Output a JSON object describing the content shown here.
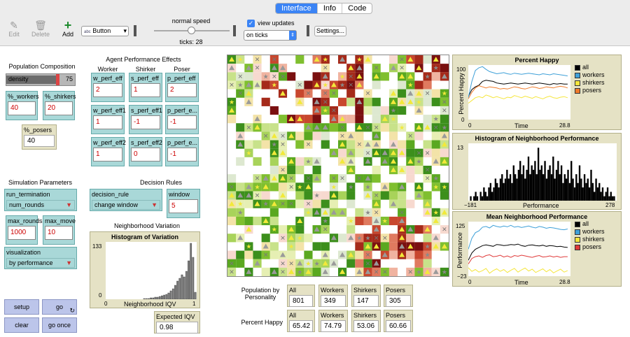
{
  "tabs": [
    "Interface",
    "Info",
    "Code"
  ],
  "toolbar": {
    "edit": "Edit",
    "delete": "Delete",
    "add": "Add",
    "widget_type": "Button",
    "speed_label": "normal speed",
    "ticks": "ticks: 28",
    "view_updates": "view updates",
    "update_mode": "on ticks",
    "settings": "Settings..."
  },
  "population": {
    "title": "Population Composition",
    "density_label": "density",
    "density_value": "75",
    "density_fraction": 0.75,
    "workers_label": "%_workers",
    "workers": "40",
    "shirkers_label": "%_shirkers",
    "shirkers": "20",
    "posers_label": "%_posers",
    "posers": "40"
  },
  "effects": {
    "title": "Agent Performance Effects",
    "col_worker": "Worker",
    "col_shirker": "Shirker",
    "col_poser": "Poser",
    "cells": [
      {
        "label": "w_perf_eff",
        "value": "2"
      },
      {
        "label": "s_perf_eff",
        "value": "1"
      },
      {
        "label": "p_perf_eff",
        "value": "2"
      },
      {
        "label": "w_perf_eff1",
        "value": "1"
      },
      {
        "label": "s_perf_eff1",
        "value": "-1"
      },
      {
        "label": "p_perf_e...",
        "value": "-1"
      },
      {
        "label": "w_perf_eff2",
        "value": "1"
      },
      {
        "label": "s_perf_eff2",
        "value": "0"
      },
      {
        "label": "p_perf_e...",
        "value": "-1"
      }
    ]
  },
  "simulation": {
    "title": "Simulation Parameters",
    "run_termination_label": "run_termination",
    "run_termination": "num_rounds",
    "max_rounds_label": "max_rounds",
    "max_rounds": "1000",
    "max_move_label": "max_move",
    "max_move": "10",
    "visualization_label": "visualization",
    "visualization": "by performance"
  },
  "decision": {
    "title": "Decision Rules",
    "rule_label": "decision_rule",
    "rule": "change window",
    "window_label": "window",
    "window": "5"
  },
  "variation": {
    "title": "Neighborhood Variation",
    "hist_title": "Histogram of Variation",
    "y_max": "133",
    "y_min": "0",
    "x_min": "0",
    "x_max": "1",
    "x_label": "Neighborhood IQV",
    "expected_label": "Expected IQV",
    "expected": "0.98"
  },
  "controls": {
    "setup": "setup",
    "go": "go",
    "clear": "clear",
    "go_once": "go once"
  },
  "stats": {
    "pop_label": "Population by Personality",
    "happy_label": "Percent Happy",
    "headers": [
      "All",
      "Workers",
      "Shirkers",
      "Posers"
    ],
    "pop_values": [
      "801",
      "349",
      "147",
      "305"
    ],
    "happy_values": [
      "65.42",
      "74.79",
      "53.06",
      "60.66"
    ]
  },
  "legend_colors": {
    "all": "#000000",
    "workers": "#3ea0d8",
    "shirkers": "#f5e63c",
    "posers_orange": "#f07a2a",
    "posers_red": "#e03a3a"
  },
  "chart_data": [
    {
      "type": "line",
      "title": "Percent Happy",
      "ylabel": "Percent Happy",
      "xlabel": "Time",
      "ylim": [
        0,
        100
      ],
      "xlim": [
        0,
        28.8
      ],
      "y_top": "100",
      "y_bottom": "0",
      "x_left": "0",
      "x_right": "28.8",
      "x": [
        0,
        1,
        2,
        3,
        4,
        5,
        6,
        7,
        8,
        9,
        10,
        11,
        12,
        13,
        14,
        15,
        16,
        17,
        18,
        19,
        20,
        21,
        22,
        23,
        24,
        25,
        26,
        27,
        28
      ],
      "series": [
        {
          "name": "all",
          "values": [
            42,
            55,
            60,
            63,
            70,
            72,
            71,
            70,
            67,
            66,
            65,
            66,
            67,
            66,
            65,
            66,
            67,
            66,
            65,
            66,
            67,
            66,
            65,
            64,
            66,
            65,
            66,
            65,
            65
          ]
        },
        {
          "name": "workers",
          "values": [
            40,
            70,
            90,
            95,
            97,
            92,
            88,
            86,
            84,
            85,
            86,
            84,
            83,
            85,
            84,
            83,
            84,
            85,
            84,
            83,
            82,
            84,
            83,
            82,
            84,
            83,
            82,
            81,
            80
          ]
        },
        {
          "name": "shirkers",
          "values": [
            30,
            35,
            40,
            42,
            40,
            45,
            43,
            40,
            42,
            40,
            38,
            41,
            40,
            44,
            42,
            40,
            43,
            41,
            39,
            42,
            40,
            38,
            41,
            43,
            40,
            39,
            41,
            42,
            40
          ]
        },
        {
          "name": "posers",
          "values": [
            38,
            50,
            58,
            62,
            60,
            58,
            60,
            59,
            58,
            56,
            57,
            56,
            58,
            60,
            59,
            57,
            56,
            58,
            60,
            59,
            57,
            58,
            60,
            59,
            58,
            60,
            61,
            60,
            58
          ]
        }
      ]
    },
    {
      "type": "bar",
      "title": "Histogram of Neighborhood Performance",
      "xlabel": "Performance",
      "ylim": [
        0,
        13
      ],
      "xlim": [
        -181,
        278
      ],
      "y_top": "13",
      "x_left": "−181",
      "x_right": "278",
      "values": [
        0,
        1,
        0,
        1,
        2,
        1,
        0,
        2,
        1,
        3,
        2,
        1,
        3,
        4,
        2,
        3,
        5,
        4,
        3,
        5,
        6,
        4,
        5,
        7,
        5,
        6,
        4,
        8,
        6,
        5,
        7,
        9,
        6,
        8,
        5,
        7,
        10,
        6,
        8,
        7,
        9,
        6,
        12,
        7,
        8,
        6,
        9,
        5,
        7,
        8,
        6,
        10,
        5,
        7,
        9,
        6,
        8,
        4,
        6,
        5,
        7,
        4,
        9,
        5,
        3,
        6,
        4,
        8,
        5,
        3,
        6,
        4,
        5,
        3,
        7,
        4,
        2,
        5,
        3,
        4,
        2,
        3,
        1,
        2,
        3,
        1,
        2,
        1,
        1,
        0
      ]
    },
    {
      "type": "line",
      "title": "Mean Neighborhood Performance",
      "ylabel": "Performance",
      "xlabel": "Time",
      "ylim": [
        -23,
        125
      ],
      "xlim": [
        0,
        28.8
      ],
      "y_top": "125",
      "y_bottom": "−23",
      "x_left": "0",
      "x_right": "28.8",
      "x": [
        0,
        1,
        2,
        3,
        4,
        5,
        6,
        7,
        8,
        9,
        10,
        11,
        12,
        13,
        14,
        15,
        16,
        17,
        18,
        19,
        20,
        21,
        22,
        23,
        24,
        25,
        26,
        27,
        28
      ],
      "series": [
        {
          "name": "all",
          "values": [
            20,
            40,
            50,
            55,
            60,
            62,
            60,
            58,
            63,
            62,
            60,
            61,
            63,
            62,
            64,
            60,
            58,
            61,
            62,
            60,
            59,
            61,
            58,
            60,
            59,
            57,
            58,
            56,
            55
          ]
        },
        {
          "name": "workers",
          "values": [
            50,
            80,
            95,
            100,
            110,
            112,
            108,
            115,
            112,
            110,
            113,
            111,
            115,
            110,
            112,
            109,
            111,
            113,
            110,
            108,
            112,
            110,
            107,
            109,
            108,
            106,
            104,
            103,
            105
          ]
        },
        {
          "name": "shirkers",
          "values": [
            0,
            -10,
            -5,
            -12,
            -8,
            -2,
            -15,
            -8,
            -3,
            -10,
            -5,
            -13,
            -7,
            -2,
            -12,
            -6,
            -1,
            -9,
            -4,
            -13,
            -8,
            -3,
            -11,
            -5,
            -14,
            -9,
            -4,
            -12,
            -8
          ]
        },
        {
          "name": "posers",
          "values": [
            10,
            25,
            30,
            32,
            28,
            33,
            35,
            30,
            31,
            34,
            29,
            32,
            28,
            33,
            31,
            34,
            32,
            30,
            28,
            31,
            33,
            29,
            30,
            32,
            29,
            31,
            28,
            30,
            30
          ]
        }
      ]
    }
  ]
}
